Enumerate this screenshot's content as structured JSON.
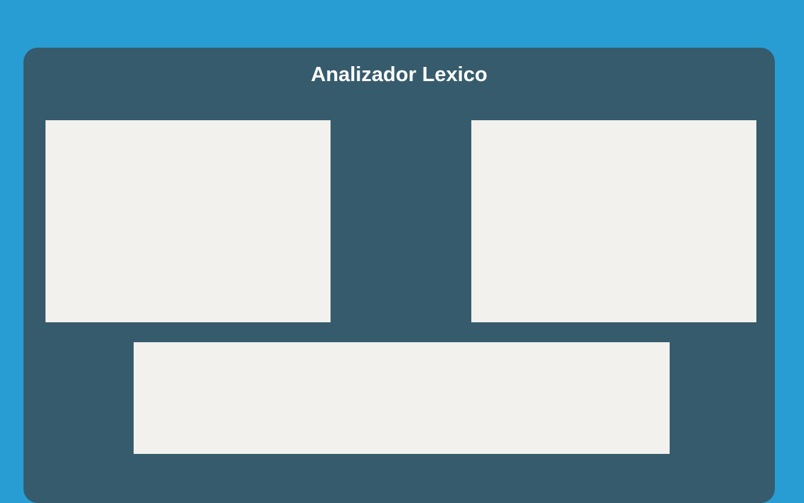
{
  "app": {
    "title": "Analizador Lexico"
  },
  "panes": {
    "input": {
      "value": "",
      "placeholder": ""
    },
    "output": {
      "value": "",
      "placeholder": ""
    },
    "console": {
      "value": "",
      "placeholder": ""
    }
  },
  "colors": {
    "page_background": "#289dd3",
    "card_background": "#365b6d",
    "pane_background": "#f2f1ed",
    "title_text": "#ffffff"
  }
}
